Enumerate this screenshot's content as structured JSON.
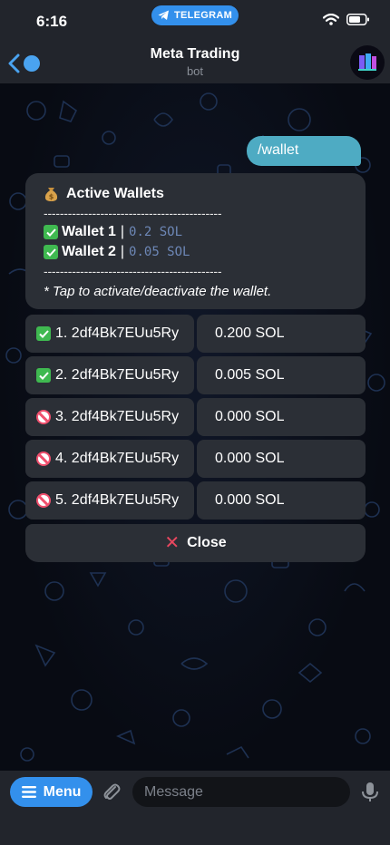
{
  "status_bar": {
    "time": "6:16",
    "app_pill": "TELEGRAM"
  },
  "header": {
    "title": "Meta Trading",
    "subtitle": "bot"
  },
  "chat": {
    "outgoing_message": "/wallet",
    "bot_message": {
      "title": "Active Wallets",
      "separator": "--------------------------------------------",
      "wallets": [
        {
          "name": "Wallet 1",
          "balance": "0.2 SOL"
        },
        {
          "name": "Wallet 2",
          "balance": "0.05 SOL"
        }
      ],
      "note": "* Tap to activate/deactivate the wallet."
    }
  },
  "keyboard": {
    "rows": [
      {
        "status": "active",
        "label": "1. 2df4Bk7EUu5Ry",
        "balance": "0.200 SOL"
      },
      {
        "status": "active",
        "label": "2. 2df4Bk7EUu5Ry",
        "balance": "0.005 SOL"
      },
      {
        "status": "inactive",
        "label": "3. 2df4Bk7EUu5Ry",
        "balance": "0.000 SOL"
      },
      {
        "status": "inactive",
        "label": "4. 2df4Bk7EUu5Ry",
        "balance": "0.000 SOL"
      },
      {
        "status": "inactive",
        "label": "5. 2df4Bk7EUu5Ry",
        "balance": "0.000 SOL"
      }
    ],
    "close_label": "Close"
  },
  "input_bar": {
    "menu_label": "Menu",
    "placeholder": "Message"
  },
  "colors": {
    "accent": "#3390ec",
    "outgoing_bubble": "#4eabc3",
    "bubble": "#2b2f36",
    "check_green": "#3fb950",
    "close_red": "#e8475f"
  }
}
